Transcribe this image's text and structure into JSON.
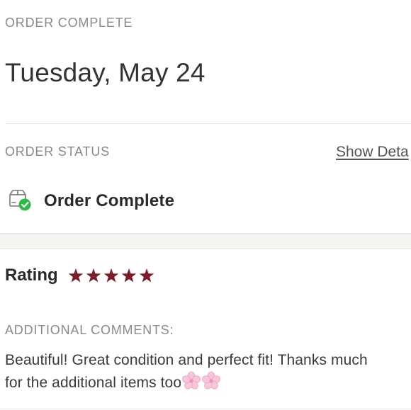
{
  "header": {
    "eyebrow": "ORDER COMPLETE",
    "date": "Tuesday, May 24"
  },
  "status_section": {
    "eyebrow": "ORDER STATUS",
    "show_details_label": "Show Deta",
    "status_icon": "package-check-icon",
    "status_label": "Order Complete",
    "status_color": "#2db84b"
  },
  "rating_section": {
    "label": "Rating",
    "stars": 5,
    "max_stars": 5,
    "star_icon": "star-icon",
    "star_color": "#7b1e2b"
  },
  "comments_section": {
    "eyebrow": "ADDITIONAL COMMENTS:",
    "text": "Beautiful! Great condition and perfect fit! Thanks much\nfor the additional items too",
    "emoji_icon": "cherry-blossom-icon"
  }
}
